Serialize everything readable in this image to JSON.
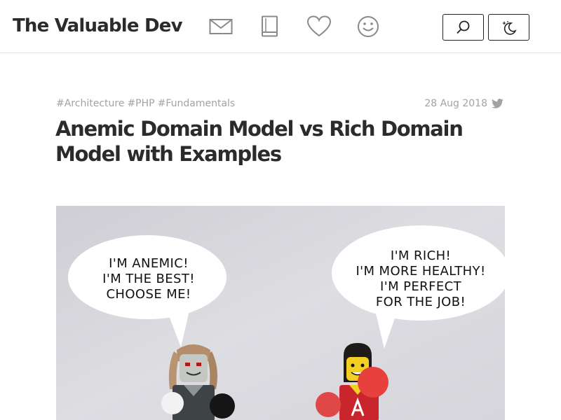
{
  "header": {
    "site_title": "The Valuable Dev",
    "nav_icons": [
      "mail-icon",
      "book-icon",
      "heart-icon",
      "smile-icon"
    ],
    "buttons": [
      "search-icon",
      "theme-toggle-icon"
    ]
  },
  "post": {
    "tags": [
      "#Architecture",
      "#PHP",
      "#Fundamentals"
    ],
    "date": "28 Aug 2018",
    "share_icon": "twitter-icon",
    "title": "Anemic Domain Model vs Rich Domain Model with Examples"
  },
  "hero_image": {
    "left_bubble": [
      "I'M ANEMIC!",
      "I'M THE BEST!",
      "CHOOSE ME!"
    ],
    "right_bubble": [
      "I'M RICH!",
      "I'M MORE HEALTHY!",
      "I'M PERFECT",
      "FOR THE JOB!"
    ]
  },
  "colors": {
    "text": "#2b2b2b",
    "muted": "#a3a3a3",
    "icon": "#8a8a8a",
    "border": "#e6e6e6",
    "photo_bg": "#d4d3d8"
  }
}
